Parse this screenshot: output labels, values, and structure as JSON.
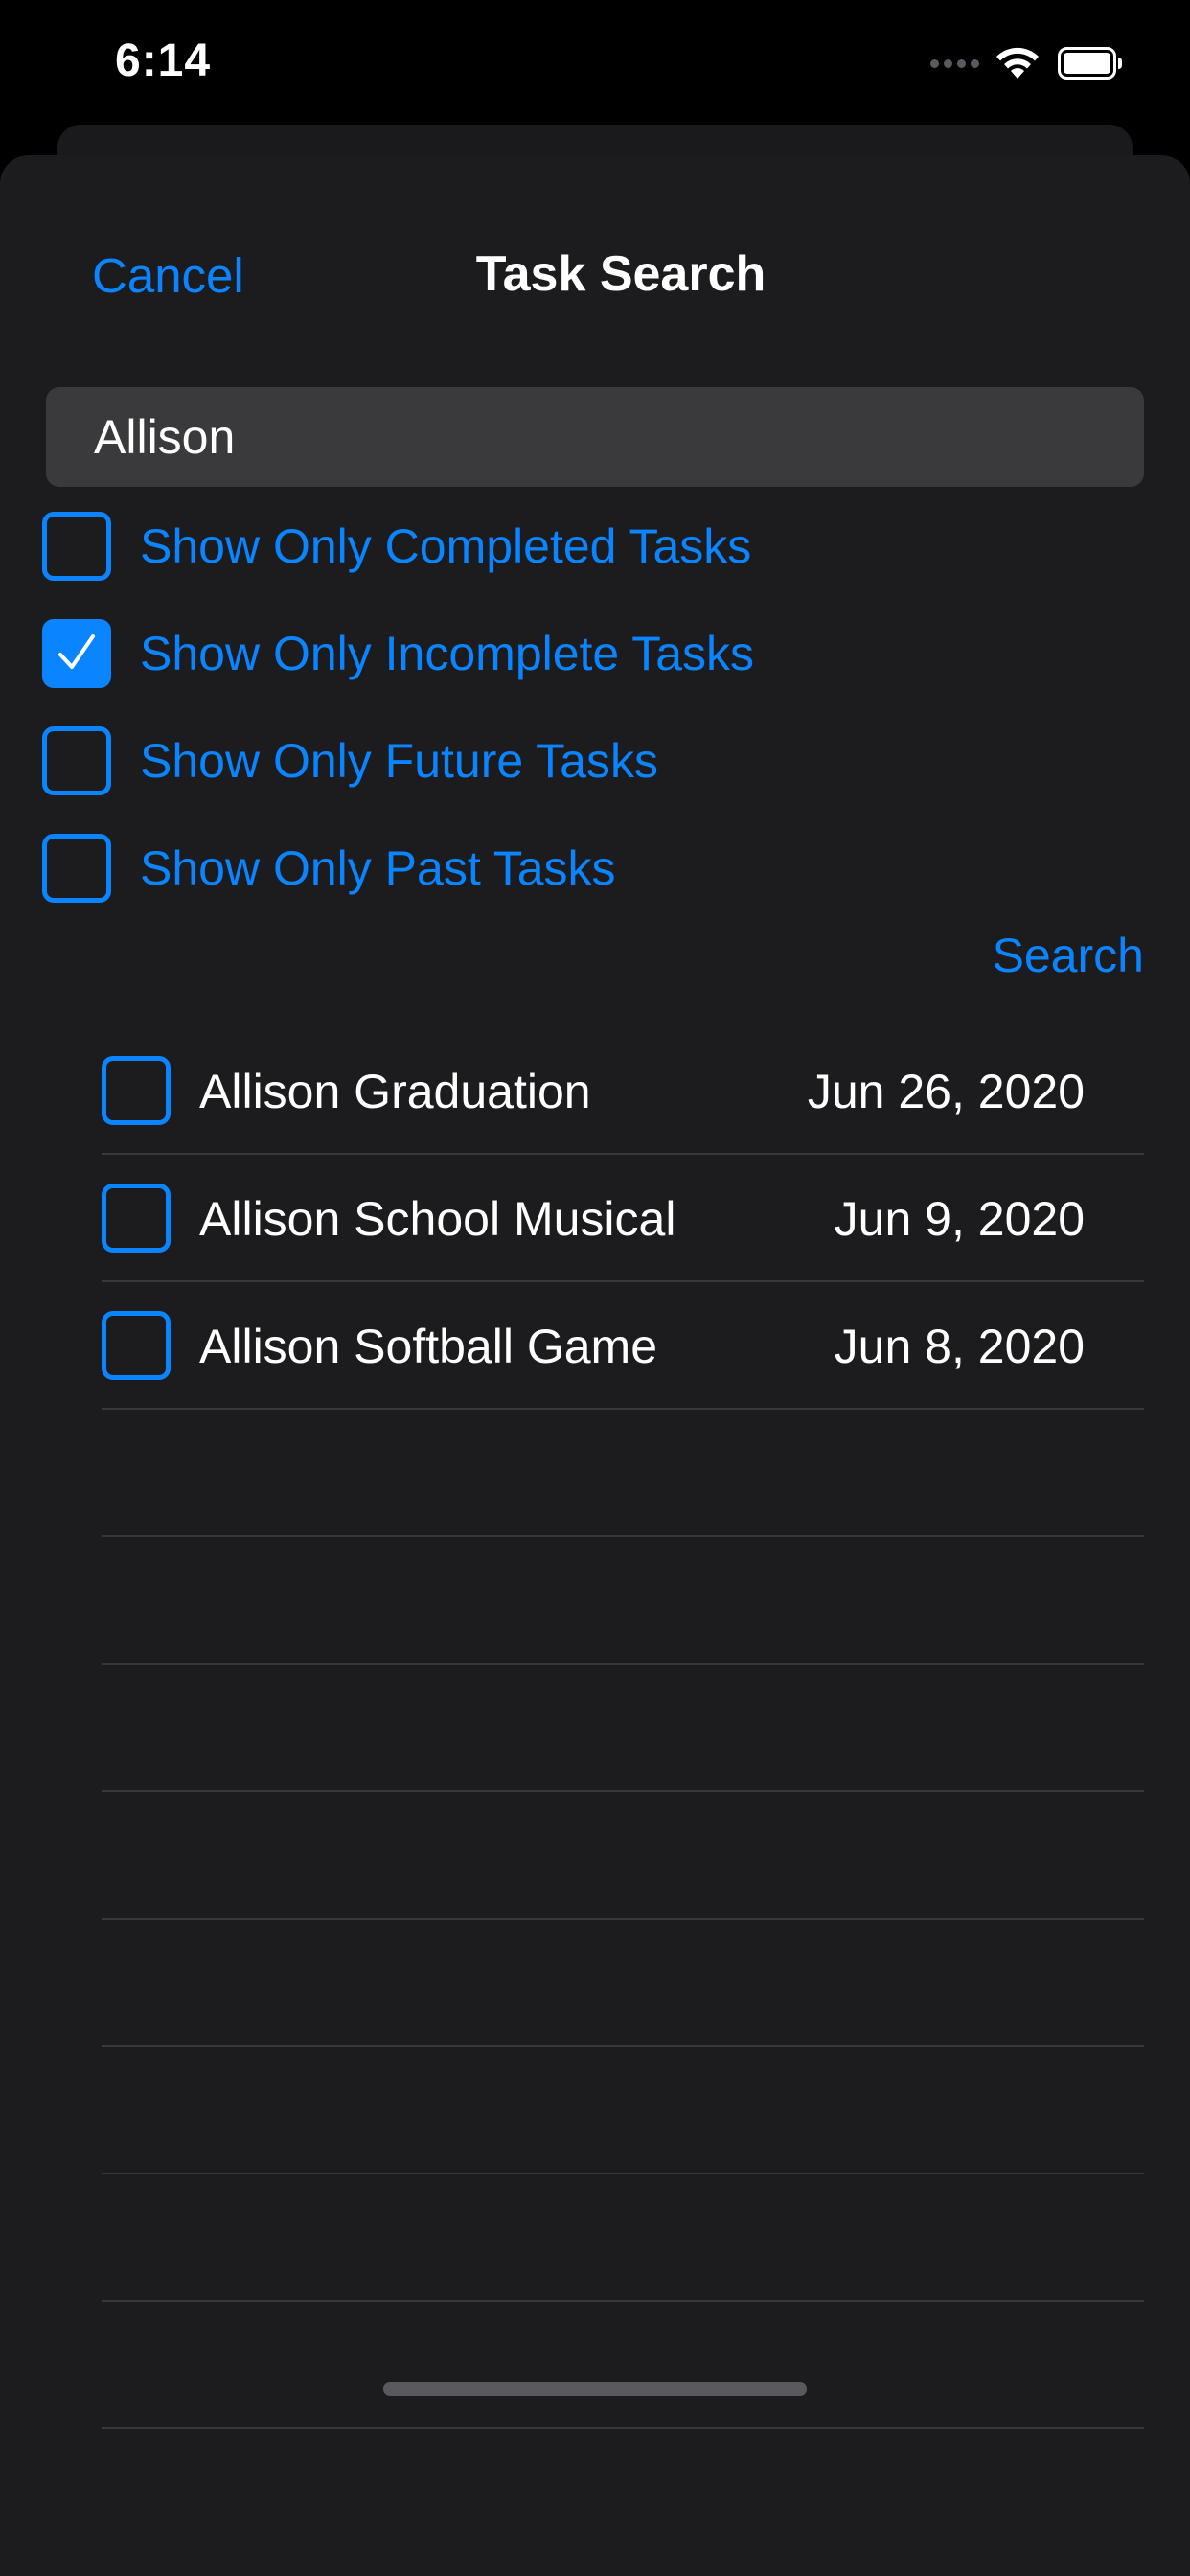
{
  "status_bar": {
    "time": "6:14",
    "icons": [
      "cellular-dots-icon",
      "wifi-icon",
      "battery-icon"
    ]
  },
  "header": {
    "cancel_label": "Cancel",
    "title": "Task Search"
  },
  "search": {
    "value": "Allison",
    "placeholder": ""
  },
  "filters": [
    {
      "label": "Show Only Completed Tasks",
      "checked": false
    },
    {
      "label": "Show Only Incomplete Tasks",
      "checked": true
    },
    {
      "label": "Show Only Future Tasks",
      "checked": false
    },
    {
      "label": "Show Only Past Tasks",
      "checked": false
    }
  ],
  "search_button_label": "Search",
  "results": [
    {
      "title": "Allison Graduation",
      "date": "Jun 26, 2020",
      "checked": false
    },
    {
      "title": "Allison School Musical",
      "date": "Jun 9, 2020",
      "checked": false
    },
    {
      "title": "Allison Softball Game",
      "date": "Jun 8, 2020",
      "checked": false
    }
  ],
  "empty_rows": 8,
  "colors": {
    "accent": "#0a84ff",
    "sheet_background": "#1c1c1e",
    "field_background": "#3a3a3c",
    "separator": "#38383a"
  }
}
